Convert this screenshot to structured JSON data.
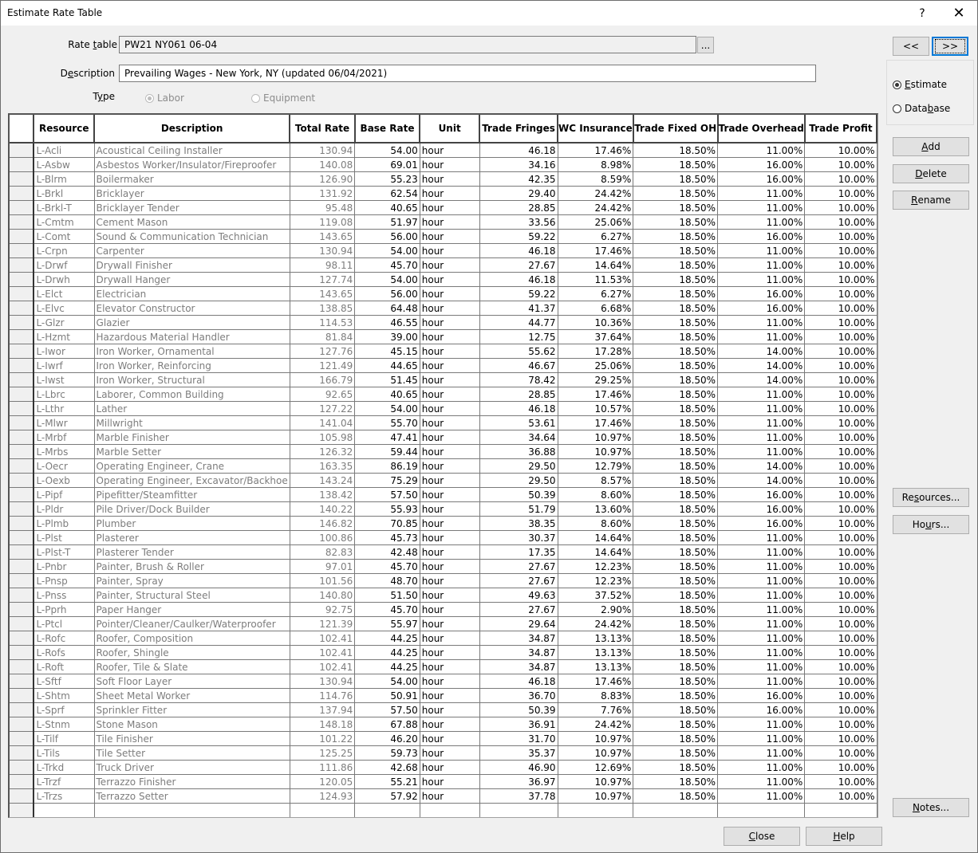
{
  "window": {
    "title": "Estimate Rate Table",
    "help_glyph": "?",
    "close_glyph": "✕"
  },
  "form": {
    "rate_table_label_pre": "Rate ",
    "rate_table_label_u": "t",
    "rate_table_label_post": "able",
    "rate_table_value": "PW21 NY061 06-04",
    "browse_label": "...",
    "description_label_pre": "D",
    "description_label_u": "e",
    "description_label_post": "scription",
    "description_value": "Prevailing Wages - New York, NY (updated 06/04/2021)",
    "type_label_pre": "T",
    "type_label_u": "y",
    "type_label_post": "pe",
    "type_options": [
      {
        "label": "Labor",
        "selected": true,
        "enabled": false
      },
      {
        "label": "Equipment",
        "selected": false,
        "enabled": false
      }
    ]
  },
  "nav": {
    "prev_label": "<<",
    "next_label": ">>"
  },
  "source": {
    "options": [
      {
        "pre": "",
        "u": "E",
        "post": "stimate",
        "selected": true
      },
      {
        "pre": "Data",
        "u": "b",
        "post": "ase",
        "selected": false
      }
    ]
  },
  "side_buttons": {
    "add": {
      "pre": "",
      "u": "A",
      "post": "dd"
    },
    "delete": {
      "pre": "",
      "u": "D",
      "post": "elete"
    },
    "rename": {
      "pre": "",
      "u": "R",
      "post": "ename"
    },
    "resources": {
      "pre": "Re",
      "u": "s",
      "post": "ources..."
    },
    "hours": {
      "pre": "Ho",
      "u": "u",
      "post": "rs..."
    },
    "notes": {
      "pre": "",
      "u": "N",
      "post": "otes..."
    }
  },
  "bottom_buttons": {
    "close": {
      "pre": "",
      "u": "C",
      "post": "lose"
    },
    "help": {
      "pre": "",
      "u": "H",
      "post": "elp"
    }
  },
  "table": {
    "columns": [
      "Resource",
      "Description",
      "Total Rate",
      "Base Rate",
      "Unit",
      "Trade Fringes",
      "WC Insurance",
      "Trade Fixed OH",
      "Trade Overhead",
      "Trade Profit"
    ],
    "rows": [
      [
        "L-Acli",
        "Acoustical Ceiling Installer",
        "130.94",
        "54.00",
        "hour",
        "46.18",
        "17.46%",
        "18.50%",
        "11.00%",
        "10.00%"
      ],
      [
        "L-Asbw",
        "Asbestos Worker/Insulator/Fireproofer",
        "140.08",
        "69.01",
        "hour",
        "34.16",
        "8.98%",
        "18.50%",
        "16.00%",
        "10.00%"
      ],
      [
        "L-Blrm",
        "Boilermaker",
        "126.90",
        "55.23",
        "hour",
        "42.35",
        "8.59%",
        "18.50%",
        "16.00%",
        "10.00%"
      ],
      [
        "L-Brkl",
        "Bricklayer",
        "131.92",
        "62.54",
        "hour",
        "29.40",
        "24.42%",
        "18.50%",
        "11.00%",
        "10.00%"
      ],
      [
        "L-Brkl-T",
        "Bricklayer Tender",
        "95.48",
        "40.65",
        "hour",
        "28.85",
        "24.42%",
        "18.50%",
        "11.00%",
        "10.00%"
      ],
      [
        "L-Cmtm",
        "Cement Mason",
        "119.08",
        "51.97",
        "hour",
        "33.56",
        "25.06%",
        "18.50%",
        "11.00%",
        "10.00%"
      ],
      [
        "L-Comt",
        "Sound & Communication Technician",
        "143.65",
        "56.00",
        "hour",
        "59.22",
        "6.27%",
        "18.50%",
        "16.00%",
        "10.00%"
      ],
      [
        "L-Crpn",
        "Carpenter",
        "130.94",
        "54.00",
        "hour",
        "46.18",
        "17.46%",
        "18.50%",
        "11.00%",
        "10.00%"
      ],
      [
        "L-Drwf",
        "Drywall Finisher",
        "98.11",
        "45.70",
        "hour",
        "27.67",
        "14.64%",
        "18.50%",
        "11.00%",
        "10.00%"
      ],
      [
        "L-Drwh",
        "Drywall Hanger",
        "127.74",
        "54.00",
        "hour",
        "46.18",
        "11.53%",
        "18.50%",
        "11.00%",
        "10.00%"
      ],
      [
        "L-Elct",
        "Electrician",
        "143.65",
        "56.00",
        "hour",
        "59.22",
        "6.27%",
        "18.50%",
        "16.00%",
        "10.00%"
      ],
      [
        "L-Elvc",
        "Elevator Constructor",
        "138.85",
        "64.48",
        "hour",
        "41.37",
        "6.68%",
        "18.50%",
        "16.00%",
        "10.00%"
      ],
      [
        "L-Glzr",
        "Glazier",
        "114.53",
        "46.55",
        "hour",
        "44.77",
        "10.36%",
        "18.50%",
        "11.00%",
        "10.00%"
      ],
      [
        "L-Hzmt",
        "Hazardous Material Handler",
        "81.84",
        "39.00",
        "hour",
        "12.75",
        "37.64%",
        "18.50%",
        "11.00%",
        "10.00%"
      ],
      [
        "L-Iwor",
        "Iron Worker, Ornamental",
        "127.76",
        "45.15",
        "hour",
        "55.62",
        "17.28%",
        "18.50%",
        "14.00%",
        "10.00%"
      ],
      [
        "L-Iwrf",
        "Iron Worker, Reinforcing",
        "121.49",
        "44.65",
        "hour",
        "46.67",
        "25.06%",
        "18.50%",
        "14.00%",
        "10.00%"
      ],
      [
        "L-Iwst",
        "Iron Worker, Structural",
        "166.79",
        "51.45",
        "hour",
        "78.42",
        "29.25%",
        "18.50%",
        "14.00%",
        "10.00%"
      ],
      [
        "L-Lbrc",
        "Laborer, Common Building",
        "92.65",
        "40.65",
        "hour",
        "28.85",
        "17.46%",
        "18.50%",
        "11.00%",
        "10.00%"
      ],
      [
        "L-Lthr",
        "Lather",
        "127.22",
        "54.00",
        "hour",
        "46.18",
        "10.57%",
        "18.50%",
        "11.00%",
        "10.00%"
      ],
      [
        "L-Mlwr",
        "Millwright",
        "141.04",
        "55.70",
        "hour",
        "53.61",
        "17.46%",
        "18.50%",
        "11.00%",
        "10.00%"
      ],
      [
        "L-Mrbf",
        "Marble Finisher",
        "105.98",
        "47.41",
        "hour",
        "34.64",
        "10.97%",
        "18.50%",
        "11.00%",
        "10.00%"
      ],
      [
        "L-Mrbs",
        "Marble Setter",
        "126.32",
        "59.44",
        "hour",
        "36.88",
        "10.97%",
        "18.50%",
        "11.00%",
        "10.00%"
      ],
      [
        "L-Oecr",
        "Operating Engineer, Crane",
        "163.35",
        "86.19",
        "hour",
        "29.50",
        "12.79%",
        "18.50%",
        "14.00%",
        "10.00%"
      ],
      [
        "L-Oexb",
        "Operating Engineer, Excavator/Backhoe",
        "143.24",
        "75.29",
        "hour",
        "29.50",
        "8.57%",
        "18.50%",
        "14.00%",
        "10.00%"
      ],
      [
        "L-Pipf",
        "Pipefitter/Steamfitter",
        "138.42",
        "57.50",
        "hour",
        "50.39",
        "8.60%",
        "18.50%",
        "16.00%",
        "10.00%"
      ],
      [
        "L-Pldr",
        "Pile Driver/Dock Builder",
        "140.22",
        "55.93",
        "hour",
        "51.79",
        "13.60%",
        "18.50%",
        "16.00%",
        "10.00%"
      ],
      [
        "L-Plmb",
        "Plumber",
        "146.82",
        "70.85",
        "hour",
        "38.35",
        "8.60%",
        "18.50%",
        "16.00%",
        "10.00%"
      ],
      [
        "L-Plst",
        "Plasterer",
        "100.86",
        "45.73",
        "hour",
        "30.37",
        "14.64%",
        "18.50%",
        "11.00%",
        "10.00%"
      ],
      [
        "L-Plst-T",
        "Plasterer Tender",
        "82.83",
        "42.48",
        "hour",
        "17.35",
        "14.64%",
        "18.50%",
        "11.00%",
        "10.00%"
      ],
      [
        "L-Pnbr",
        "Painter, Brush & Roller",
        "97.01",
        "45.70",
        "hour",
        "27.67",
        "12.23%",
        "18.50%",
        "11.00%",
        "10.00%"
      ],
      [
        "L-Pnsp",
        "Painter, Spray",
        "101.56",
        "48.70",
        "hour",
        "27.67",
        "12.23%",
        "18.50%",
        "11.00%",
        "10.00%"
      ],
      [
        "L-Pnss",
        "Painter, Structural Steel",
        "140.80",
        "51.50",
        "hour",
        "49.63",
        "37.52%",
        "18.50%",
        "11.00%",
        "10.00%"
      ],
      [
        "L-Pprh",
        "Paper Hanger",
        "92.75",
        "45.70",
        "hour",
        "27.67",
        "2.90%",
        "18.50%",
        "11.00%",
        "10.00%"
      ],
      [
        "L-Ptcl",
        "Pointer/Cleaner/Caulker/Waterproofer",
        "121.39",
        "55.97",
        "hour",
        "29.64",
        "24.42%",
        "18.50%",
        "11.00%",
        "10.00%"
      ],
      [
        "L-Rofc",
        "Roofer, Composition",
        "102.41",
        "44.25",
        "hour",
        "34.87",
        "13.13%",
        "18.50%",
        "11.00%",
        "10.00%"
      ],
      [
        "L-Rofs",
        "Roofer, Shingle",
        "102.41",
        "44.25",
        "hour",
        "34.87",
        "13.13%",
        "18.50%",
        "11.00%",
        "10.00%"
      ],
      [
        "L-Roft",
        "Roofer, Tile & Slate",
        "102.41",
        "44.25",
        "hour",
        "34.87",
        "13.13%",
        "18.50%",
        "11.00%",
        "10.00%"
      ],
      [
        "L-Sftf",
        "Soft Floor Layer",
        "130.94",
        "54.00",
        "hour",
        "46.18",
        "17.46%",
        "18.50%",
        "11.00%",
        "10.00%"
      ],
      [
        "L-Shtm",
        "Sheet Metal Worker",
        "114.76",
        "50.91",
        "hour",
        "36.70",
        "8.83%",
        "18.50%",
        "16.00%",
        "10.00%"
      ],
      [
        "L-Sprf",
        "Sprinkler Fitter",
        "137.94",
        "57.50",
        "hour",
        "50.39",
        "7.76%",
        "18.50%",
        "16.00%",
        "10.00%"
      ],
      [
        "L-Stnm",
        "Stone Mason",
        "148.18",
        "67.88",
        "hour",
        "36.91",
        "24.42%",
        "18.50%",
        "11.00%",
        "10.00%"
      ],
      [
        "L-Tilf",
        "Tile Finisher",
        "101.22",
        "46.20",
        "hour",
        "31.70",
        "10.97%",
        "18.50%",
        "11.00%",
        "10.00%"
      ],
      [
        "L-Tils",
        "Tile Setter",
        "125.25",
        "59.73",
        "hour",
        "35.37",
        "10.97%",
        "18.50%",
        "11.00%",
        "10.00%"
      ],
      [
        "L-Trkd",
        "Truck Driver",
        "111.86",
        "42.68",
        "hour",
        "46.90",
        "12.69%",
        "18.50%",
        "11.00%",
        "10.00%"
      ],
      [
        "L-Trzf",
        "Terrazzo Finisher",
        "120.05",
        "55.21",
        "hour",
        "36.97",
        "10.97%",
        "18.50%",
        "11.00%",
        "10.00%"
      ],
      [
        "L-Trzs",
        "Terrazzo Setter",
        "124.93",
        "57.92",
        "hour",
        "37.78",
        "10.97%",
        "18.50%",
        "11.00%",
        "10.00%"
      ]
    ]
  }
}
